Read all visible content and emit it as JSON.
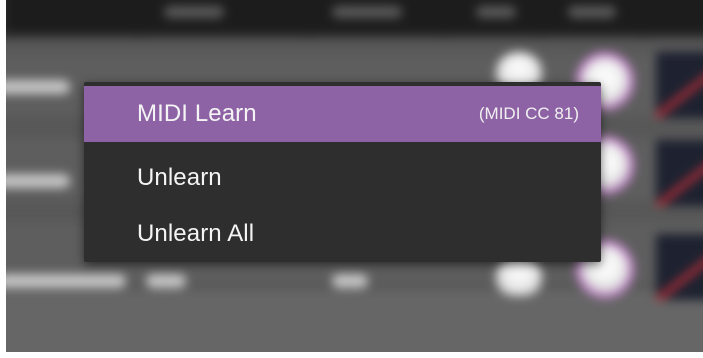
{
  "context_menu": {
    "items": [
      {
        "label": "MIDI Learn",
        "shortcut": "(MIDI CC 81)",
        "highlighted": true
      },
      {
        "label": "Unlearn",
        "shortcut": "",
        "highlighted": false
      },
      {
        "label": "Unlearn All",
        "shortcut": "",
        "highlighted": false
      }
    ]
  },
  "colors": {
    "menu_background": "#2e2e2e",
    "menu_highlight": "#8e63a6",
    "menu_text": "#f4f4f4",
    "background_panel": "#585858",
    "knob_ring_accent": "#c77fd0",
    "graph_line": "#d0303a"
  }
}
